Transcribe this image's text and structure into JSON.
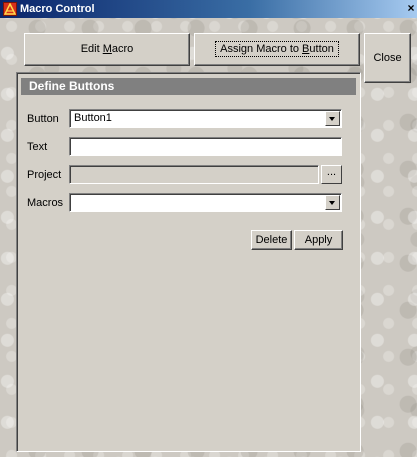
{
  "window": {
    "title": "Macro Control",
    "close_glyph": "×"
  },
  "tabs": {
    "edit_label_pre": "Edit ",
    "edit_label_ul": "M",
    "edit_label_post": "acro",
    "assign_label_pre": "Assign Macro to ",
    "assign_label_ul": "B",
    "assign_label_post": "utton"
  },
  "close_button": {
    "label": "Close"
  },
  "panel": {
    "header": "Define Buttons",
    "button_label": "Button",
    "button_value": "Button1",
    "text_label": "Text",
    "text_value": "",
    "project_label": "Project",
    "project_value": "",
    "browse_label": "...",
    "macros_label": "Macros",
    "macros_value": ""
  },
  "actions": {
    "delete_label": "Delete",
    "apply_label": "Apply"
  },
  "colors": {
    "titlebar_start": "#0a246a",
    "titlebar_end": "#a6caf0",
    "face": "#d4d0c8",
    "header_gray": "#808080"
  },
  "icons": {
    "app": "macro-app-icon",
    "dropdown": "chevron-down-icon"
  }
}
